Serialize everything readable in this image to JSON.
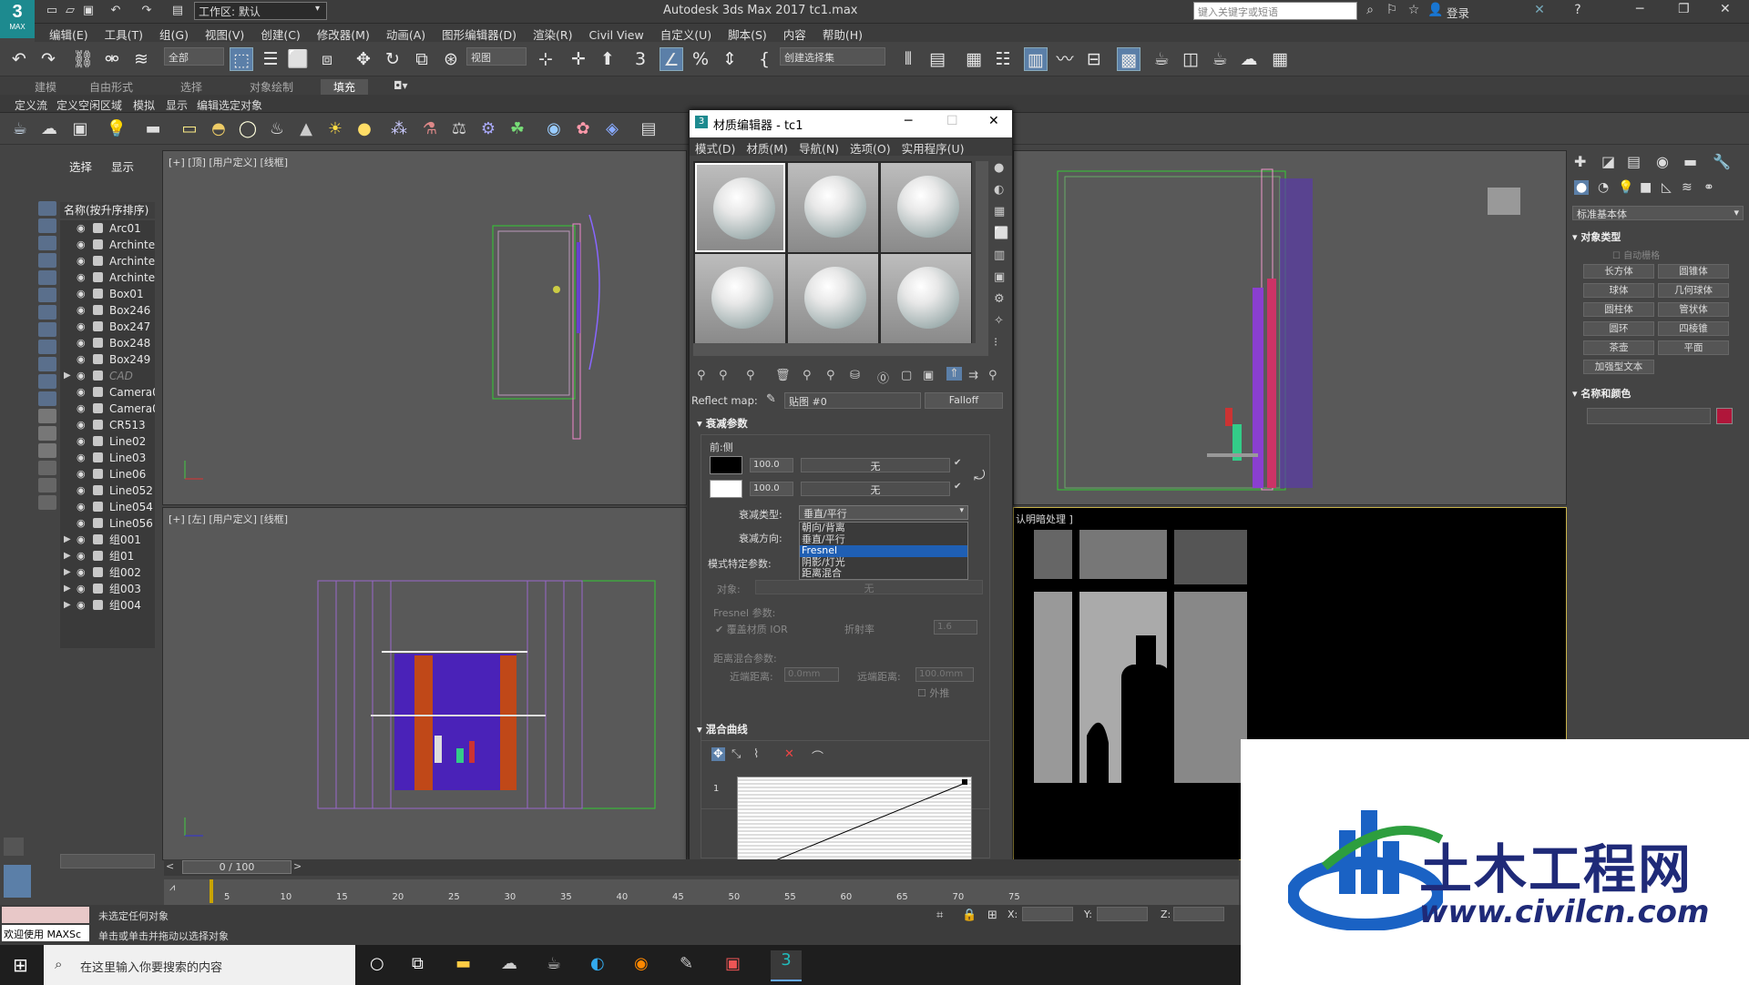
{
  "title_bar": {
    "workspace": "工作区: 默认",
    "app_title": "Autodesk 3ds Max 2017      tc1.max",
    "search_placeholder": "键入关键字或短语",
    "login": "登录",
    "logo": "3",
    "logo_sub": "MAX"
  },
  "menu": [
    "编辑(E)",
    "工具(T)",
    "组(G)",
    "视图(V)",
    "创建(C)",
    "修改器(M)",
    "动画(A)",
    "图形编辑器(D)",
    "渲染(R)",
    "Civil View",
    "自定义(U)",
    "脚本(S)",
    "内容",
    "帮助(H)"
  ],
  "main_toolbar": {
    "selection_filter": "全部",
    "ref_coord": "视图",
    "named_selection": "创建选择集"
  },
  "ribbon": {
    "tabs": [
      "建模",
      "自由形式",
      "选择",
      "对象绘制",
      "填充"
    ],
    "sub_items": [
      "定义流",
      "定义空闲区域",
      "模拟",
      "显示",
      "编辑选定对象"
    ]
  },
  "scene_explorer": {
    "tabs": [
      "选择",
      "显示"
    ],
    "header": "名称(按升序排序)",
    "items": [
      {
        "name": "Arc01",
        "group": false,
        "disabled": false
      },
      {
        "name": "Archinter",
        "group": false,
        "disabled": false
      },
      {
        "name": "Archinter",
        "group": false,
        "disabled": false
      },
      {
        "name": "Archinter",
        "group": false,
        "disabled": false
      },
      {
        "name": "Box01",
        "group": false,
        "disabled": false
      },
      {
        "name": "Box246",
        "group": false,
        "disabled": false
      },
      {
        "name": "Box247",
        "group": false,
        "disabled": false
      },
      {
        "name": "Box248",
        "group": false,
        "disabled": false
      },
      {
        "name": "Box249",
        "group": false,
        "disabled": false
      },
      {
        "name": "CAD",
        "group": true,
        "disabled": true
      },
      {
        "name": "Camera0",
        "group": false,
        "disabled": false
      },
      {
        "name": "Camera0",
        "group": false,
        "disabled": false
      },
      {
        "name": "CR513",
        "group": false,
        "disabled": false
      },
      {
        "name": "Line02",
        "group": false,
        "disabled": false
      },
      {
        "name": "Line03",
        "group": false,
        "disabled": false
      },
      {
        "name": "Line06",
        "group": false,
        "disabled": false
      },
      {
        "name": "Line052",
        "group": false,
        "disabled": false
      },
      {
        "name": "Line054",
        "group": false,
        "disabled": false
      },
      {
        "name": "Line056",
        "group": false,
        "disabled": false
      },
      {
        "name": "组001",
        "group": true,
        "disabled": false
      },
      {
        "name": "组01",
        "group": true,
        "disabled": false
      },
      {
        "name": "组002",
        "group": true,
        "disabled": false
      },
      {
        "name": "组003",
        "group": true,
        "disabled": false
      },
      {
        "name": "组004",
        "group": true,
        "disabled": false
      }
    ]
  },
  "viewports": {
    "top_left": "[+] [顶] [用户定义] [线框]",
    "bottom_left": "[+] [左] [用户定义] [线框]",
    "bottom_right_tail": "认明暗处理 ]"
  },
  "material_editor": {
    "title": "材质编辑器 - tc1",
    "menu": [
      "模式(D)",
      "材质(M)",
      "导航(N)",
      "选项(O)",
      "实用程序(U)"
    ],
    "reflect_map_label": "Reflect map:",
    "map_name": "贴图 #0",
    "map_type": "Falloff",
    "falloff_rollout": "衰减参数",
    "front_side": "前:侧",
    "value1": "100.0",
    "value2": "100.0",
    "none1": "无",
    "none2": "无",
    "falloff_type_label": "衰减类型:",
    "falloff_type_value": "垂直/平行",
    "falloff_dir_label": "衰减方向:",
    "falloff_options": [
      "朝向/背离",
      "垂直/平行",
      "Fresnel",
      "阴影/灯光",
      "距离混合"
    ],
    "highlighted_option": "Fresnel",
    "mode_params": "模式特定参数:",
    "object_label": "对象:",
    "object_none": "无",
    "fresnel_params": "Fresnel 参数:",
    "override_ior": "覆盖材质 IOR",
    "ior_label": "折射率",
    "ior_value": "1.6",
    "distance_params": "距离混合参数:",
    "near_label": "近端距离:",
    "near_value": "0.0mm",
    "far_label": "远端距离:",
    "far_value": "100.0mm",
    "extrapolate": "外推",
    "mix_curve": "混合曲线",
    "curve_index": "1"
  },
  "command_panel": {
    "category": "标准基本体",
    "object_type": "对象类型",
    "autogrid": "自动栅格",
    "buttons": [
      "长方体",
      "圆锥体",
      "球体",
      "几何球体",
      "圆柱体",
      "管状体",
      "圆环",
      "四棱锥",
      "茶壶",
      "平面",
      "加强型文本"
    ],
    "name_color": "名称和颜色",
    "object_color": "#b0163a"
  },
  "timeline": {
    "frame": "0 / 100",
    "ticks": [
      "5",
      "10",
      "15",
      "20",
      "25",
      "30",
      "35",
      "40",
      "45",
      "50",
      "55",
      "60",
      "65",
      "70",
      "75"
    ]
  },
  "status": {
    "no_selection": "未选定任何对象",
    "hint": "单击或单击并拖动以选择对象",
    "welcome": "欢迎使用 MAXSc",
    "x_label": "X:",
    "y_label": "Y:",
    "z_label": "Z:"
  },
  "taskbar": {
    "search_placeholder": "在这里输入你要搜索的内容"
  },
  "watermark": {
    "cn": "土木工程网",
    "url": "www.civilcn.com"
  }
}
